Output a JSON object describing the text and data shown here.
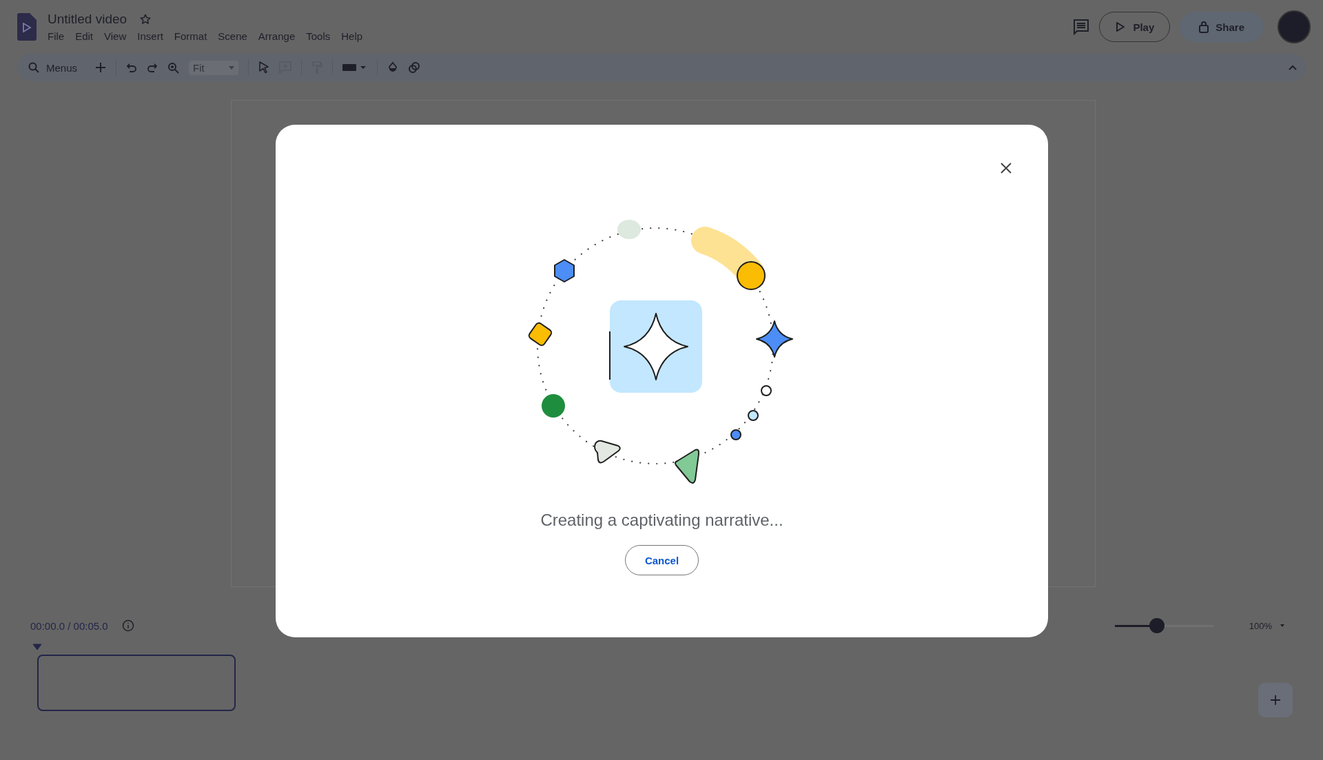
{
  "document": {
    "title": "Untitled video",
    "starred": false
  },
  "menu_bar": [
    "File",
    "Edit",
    "View",
    "Insert",
    "Format",
    "Scene",
    "Arrange",
    "Tools",
    "Help"
  ],
  "toolbar": {
    "search_label": "Menus",
    "zoom_select": {
      "value": "Fit",
      "disabled": true
    }
  },
  "header_actions": {
    "play": "Play",
    "share": "Share"
  },
  "timeline": {
    "time": "00:00.0 / 00:05.0",
    "zoom_slider": {
      "level": 0.43
    },
    "zoom_value": "100%"
  },
  "dialog": {
    "message": "Creating a captivating narrative...",
    "cancel": "Cancel"
  }
}
